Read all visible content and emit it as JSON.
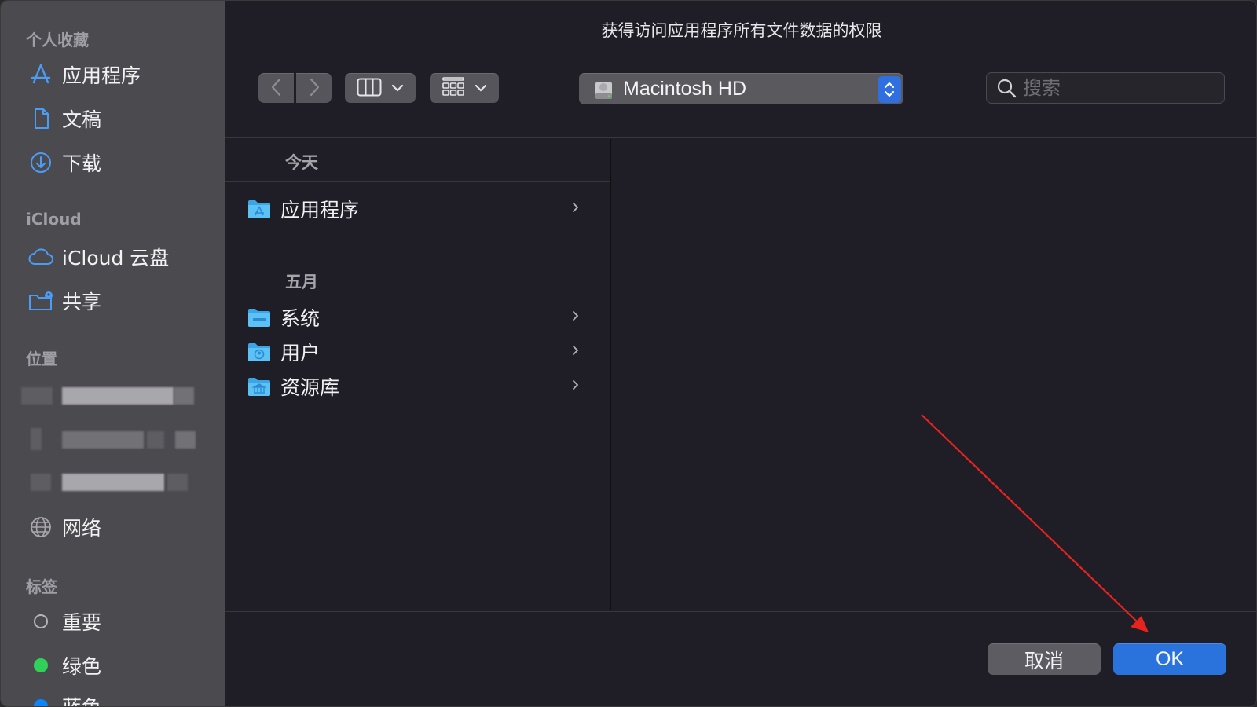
{
  "dialog": {
    "title": "获得访问应用程序所有文件数据的权限"
  },
  "sidebar": {
    "favorites_header": "个人收藏",
    "favorites": [
      {
        "label": "应用程序",
        "icon": "applications-icon"
      },
      {
        "label": "文稿",
        "icon": "document-icon"
      },
      {
        "label": "下载",
        "icon": "download-icon"
      }
    ],
    "icloud_header": "iCloud",
    "icloud": [
      {
        "label": "iCloud 云盘",
        "icon": "cloud-icon"
      },
      {
        "label": "共享",
        "icon": "shared-folder-icon"
      }
    ],
    "locations_header": "位置",
    "locations": [
      {
        "label": "网络",
        "icon": "globe-icon"
      }
    ],
    "tags_header": "标签",
    "tags": [
      {
        "label": "重要",
        "color": ""
      },
      {
        "label": "绿色",
        "color": "#30d158"
      },
      {
        "label": "蓝色",
        "color": "#0a84ff"
      }
    ]
  },
  "toolbar": {
    "location": "Macintosh HD",
    "search_placeholder": "搜索"
  },
  "browser": {
    "groups": [
      {
        "header": "今天",
        "items": [
          {
            "name": "应用程序",
            "icon": "applications-folder-icon"
          }
        ]
      },
      {
        "header": "五月",
        "items": [
          {
            "name": "系统",
            "icon": "system-folder-icon"
          },
          {
            "name": "用户",
            "icon": "users-folder-icon"
          },
          {
            "name": "资源库",
            "icon": "library-folder-icon"
          }
        ]
      }
    ]
  },
  "footer": {
    "cancel_label": "取消",
    "ok_label": "OK"
  },
  "colors": {
    "accent": "#2a73dd",
    "annotation_arrow": "#e8231f"
  }
}
